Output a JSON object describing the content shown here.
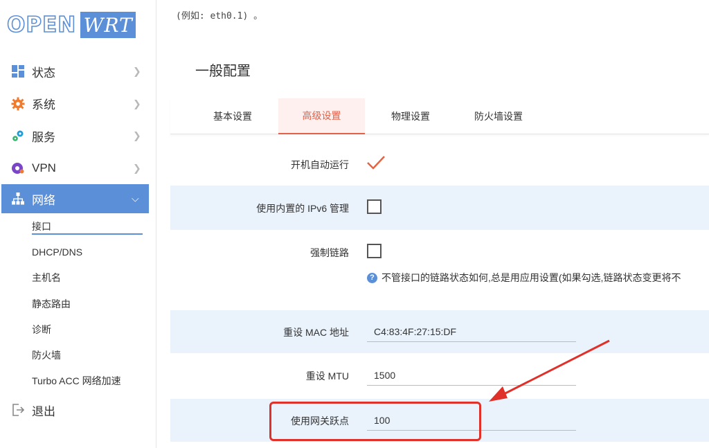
{
  "logo": {
    "part1": "OPEN",
    "part2": "WRT"
  },
  "sidebar": {
    "items": [
      {
        "label": "状态",
        "icon": "dashboard-icon"
      },
      {
        "label": "系统",
        "icon": "gear-icon"
      },
      {
        "label": "服务",
        "icon": "services-icon"
      },
      {
        "label": "VPN",
        "icon": "vpn-icon"
      },
      {
        "label": "网络",
        "icon": "network-icon"
      },
      {
        "label": "退出",
        "icon": "logout-icon"
      }
    ],
    "sub_items": [
      {
        "label": "接口"
      },
      {
        "label": "DHCP/DNS"
      },
      {
        "label": "主机名"
      },
      {
        "label": "静态路由"
      },
      {
        "label": "诊断"
      },
      {
        "label": "防火墙"
      },
      {
        "label": "Turbo ACC 网络加速"
      }
    ]
  },
  "main": {
    "top_hint": "(例如: eth0.1) 。",
    "section_title": "一般配置",
    "tabs": [
      {
        "label": "基本设置"
      },
      {
        "label": "高级设置"
      },
      {
        "label": "物理设置"
      },
      {
        "label": "防火墙设置"
      }
    ],
    "fields": {
      "autostart": {
        "label": "开机自动运行",
        "checked": true
      },
      "ipv6": {
        "label": "使用内置的 IPv6 管理",
        "checked": false
      },
      "force_link": {
        "label": "强制链路",
        "checked": false,
        "help": "不管接口的链路状态如何,总是用应用设置(如果勾选,链路状态变更将不"
      },
      "mac": {
        "label": "重设 MAC 地址",
        "value": "C4:83:4F:27:15:DF"
      },
      "mtu": {
        "label": "重设 MTU",
        "value": "1500"
      },
      "metric": {
        "label": "使用网关跃点",
        "value": "100"
      }
    }
  },
  "colors": {
    "accent": "#5b8fd8",
    "tab_active": "#e36049",
    "highlight": "#e0302a",
    "row_shade": "#eaf2fb"
  }
}
